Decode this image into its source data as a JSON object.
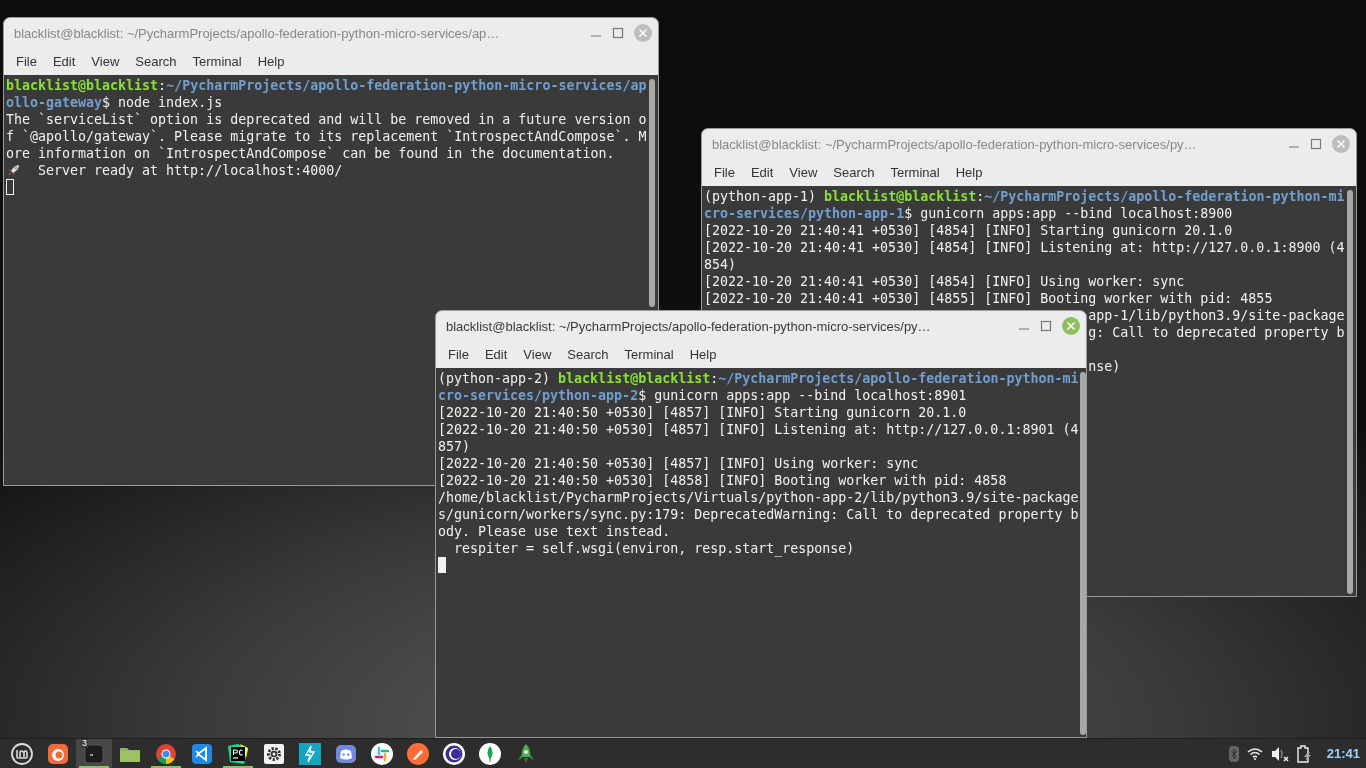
{
  "windows": [
    {
      "title": "blacklist@blacklist: ~/PycharmProjects/apollo-federation-python-micro-services/ap…",
      "active": false,
      "menu": [
        "File",
        "Edit",
        "View",
        "Search",
        "Terminal",
        "Help"
      ],
      "lines": [
        {
          "kind": "prompt",
          "user": "blacklist@blacklist",
          "separator": ":",
          "path": "~/PycharmProjects/apollo-federation-python-micro-services/apollo-gateway",
          "command": "$ node index.js"
        },
        {
          "kind": "text",
          "text": "The `serviceList` option is deprecated and will be removed in a future version of `@apollo/gateway`. Please migrate to its replacement `IntrospectAndCompose`. More information on `IntrospectAndCompose` can be found in the documentation."
        },
        {
          "kind": "rocket",
          "text": "  Server ready at http://localhost:4000/"
        },
        {
          "kind": "cursor"
        }
      ]
    },
    {
      "title": "blacklist@blacklist: ~/PycharmProjects/apollo-federation-python-micro-services/py…",
      "active": false,
      "menu": [
        "File",
        "Edit",
        "View",
        "Search",
        "Terminal",
        "Help"
      ],
      "lines": [
        {
          "kind": "prompt",
          "env": "(python-app-1) ",
          "user": "blacklist@blacklist",
          "separator": ":",
          "path": "~/PycharmProjects/apollo-federation-python-micro-services/python-app-1",
          "command": "$ gunicorn apps:app --bind localhost:8900"
        },
        {
          "kind": "text",
          "text": "[2022-10-20 21:40:41 +0530] [4854] [INFO] Starting gunicorn 20.1.0"
        },
        {
          "kind": "text",
          "text": "[2022-10-20 21:40:41 +0530] [4854] [INFO] Listening at: http://127.0.0.1:8900 (4854)"
        },
        {
          "kind": "text",
          "text": "[2022-10-20 21:40:41 +0530] [4854] [INFO] Using worker: sync"
        },
        {
          "kind": "text",
          "text": "[2022-10-20 21:40:41 +0530] [4855] [INFO] Booting worker with pid: 4855"
        },
        {
          "kind": "partial",
          "text": "app-1/lib/python3.9/site-package"
        },
        {
          "kind": "partial",
          "text": "g: Call to deprecated property b"
        },
        {
          "kind": "blank"
        },
        {
          "kind": "partial",
          "text": "nse)"
        }
      ]
    },
    {
      "title": "blacklist@blacklist: ~/PycharmProjects/apollo-federation-python-micro-services/py…",
      "active": true,
      "menu": [
        "File",
        "Edit",
        "View",
        "Search",
        "Terminal",
        "Help"
      ],
      "lines": [
        {
          "kind": "prompt",
          "env": "(python-app-2) ",
          "user": "blacklist@blacklist",
          "separator": ":",
          "path": "~/PycharmProjects/apollo-federation-python-micro-services/python-app-2",
          "command": "$ gunicorn apps:app --bind localhost:8901"
        },
        {
          "kind": "text",
          "text": "[2022-10-20 21:40:50 +0530] [4857] [INFO] Starting gunicorn 20.1.0"
        },
        {
          "kind": "text",
          "text": "[2022-10-20 21:40:50 +0530] [4857] [INFO] Listening at: http://127.0.0.1:8901 (4857)"
        },
        {
          "kind": "text",
          "text": "[2022-10-20 21:40:50 +0530] [4857] [INFO] Using worker: sync"
        },
        {
          "kind": "text",
          "text": "[2022-10-20 21:40:50 +0530] [4858] [INFO] Booting worker with pid: 4858"
        },
        {
          "kind": "text",
          "text": "/home/blacklist/PycharmProjects/Virtuals/python-app-2/lib/python3.9/site-packages/gunicorn/workers/sync.py:179: DeprecatedWarning: Call to deprecated property body. Please use text instead."
        },
        {
          "kind": "text",
          "text": "  respiter = self.wsgi(environ, resp.start_response)"
        },
        {
          "kind": "cursor"
        }
      ]
    }
  ],
  "taskbar": {
    "apps": [
      {
        "kind": "mint",
        "running": false,
        "focused": false
      },
      {
        "kind": "firefox",
        "running": false,
        "focused": false
      },
      {
        "kind": "terminal",
        "running": true,
        "focused": true,
        "badge": "3"
      },
      {
        "kind": "files",
        "running": false,
        "focused": false
      },
      {
        "kind": "chrome",
        "running": true,
        "focused": false
      },
      {
        "kind": "vscode",
        "running": false,
        "focused": false
      },
      {
        "kind": "pycharm",
        "running": true,
        "focused": false
      },
      {
        "kind": "settings",
        "running": false,
        "focused": false
      },
      {
        "kind": "bolt",
        "running": false,
        "focused": false
      },
      {
        "kind": "discord",
        "running": false,
        "focused": false
      },
      {
        "kind": "slack",
        "running": false,
        "focused": false
      },
      {
        "kind": "postman",
        "running": false,
        "focused": false
      },
      {
        "kind": "ring",
        "running": false,
        "focused": false
      },
      {
        "kind": "mongo",
        "running": false,
        "focused": false
      },
      {
        "kind": "rocket",
        "running": false,
        "focused": false
      }
    ],
    "clock": "21:41"
  }
}
